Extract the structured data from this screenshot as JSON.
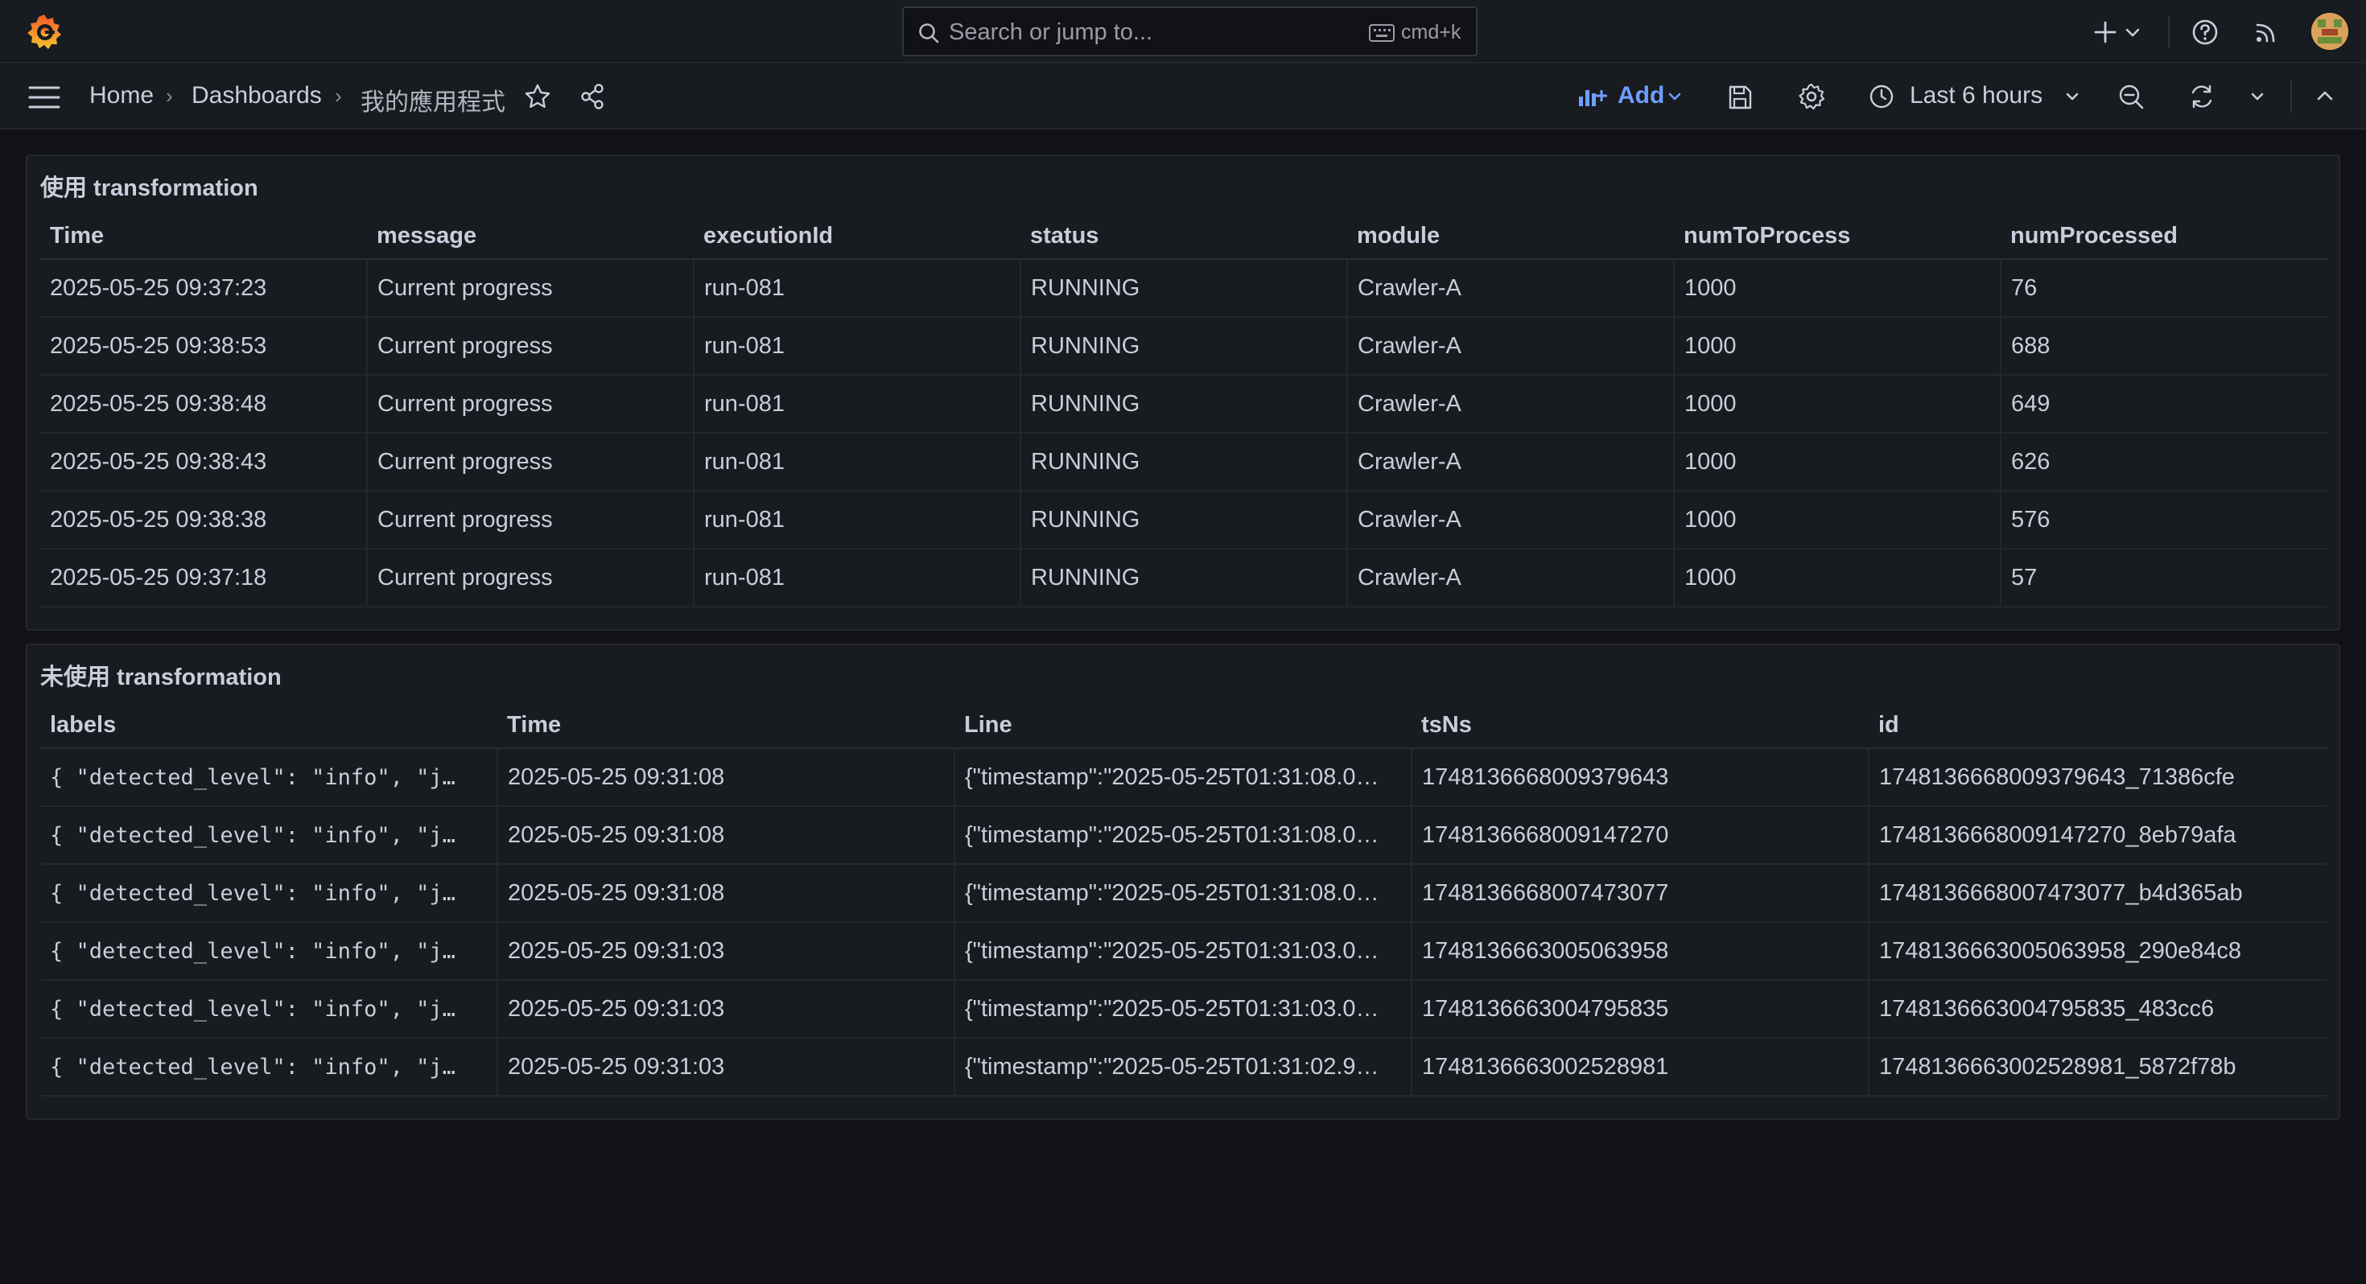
{
  "topbar": {
    "logo_icon": "grafana-logo-icon",
    "search": {
      "placeholder": "Search or jump to...",
      "shortcut": "cmd+k"
    },
    "icons": [
      "plus-icon",
      "chevron-down-icon",
      "help-icon",
      "news-icon",
      "avatar"
    ]
  },
  "navbar": {
    "breadcrumb": [
      "Home",
      "Dashboards",
      "我的應用程式"
    ],
    "add_label": "Add",
    "time_range": "Last 6 hours",
    "accent": "#6e9fff"
  },
  "panels": [
    {
      "title": "使用 transformation",
      "columns": [
        "Time",
        "message",
        "executionId",
        "status",
        "module",
        "numToProcess",
        "numProcessed"
      ],
      "rows": [
        [
          "2025-05-25 09:37:23",
          "Current progress",
          "run-081",
          "RUNNING",
          "Crawler-A",
          "1000",
          "76"
        ],
        [
          "2025-05-25 09:38:53",
          "Current progress",
          "run-081",
          "RUNNING",
          "Crawler-A",
          "1000",
          "688"
        ],
        [
          "2025-05-25 09:38:48",
          "Current progress",
          "run-081",
          "RUNNING",
          "Crawler-A",
          "1000",
          "649"
        ],
        [
          "2025-05-25 09:38:43",
          "Current progress",
          "run-081",
          "RUNNING",
          "Crawler-A",
          "1000",
          "626"
        ],
        [
          "2025-05-25 09:38:38",
          "Current progress",
          "run-081",
          "RUNNING",
          "Crawler-A",
          "1000",
          "576"
        ],
        [
          "2025-05-25 09:37:18",
          "Current progress",
          "run-081",
          "RUNNING",
          "Crawler-A",
          "1000",
          "57"
        ]
      ]
    },
    {
      "title": "未使用 transformation",
      "columns": [
        "labels",
        "Time",
        "Line",
        "tsNs",
        "id"
      ],
      "rows": [
        [
          "{ \"detected_level\": \"info\", \"j…",
          "2025-05-25 09:31:08",
          "{\"timestamp\":\"2025-05-25T01:31:08.0…",
          "1748136668009379643",
          "1748136668009379643_71386cfe"
        ],
        [
          "{ \"detected_level\": \"info\", \"j…",
          "2025-05-25 09:31:08",
          "{\"timestamp\":\"2025-05-25T01:31:08.0…",
          "1748136668009147270",
          "1748136668009147270_8eb79afa"
        ],
        [
          "{ \"detected_level\": \"info\", \"j…",
          "2025-05-25 09:31:08",
          "{\"timestamp\":\"2025-05-25T01:31:08.0…",
          "1748136668007473077",
          "1748136668007473077_b4d365ab"
        ],
        [
          "{ \"detected_level\": \"info\", \"j…",
          "2025-05-25 09:31:03",
          "{\"timestamp\":\"2025-05-25T01:31:03.0…",
          "1748136663005063958",
          "1748136663005063958_290e84c8"
        ],
        [
          "{ \"detected_level\": \"info\", \"j…",
          "2025-05-25 09:31:03",
          "{\"timestamp\":\"2025-05-25T01:31:03.0…",
          "1748136663004795835",
          "1748136663004795835_483cc6"
        ],
        [
          "{ \"detected_level\": \"info\", \"j…",
          "2025-05-25 09:31:03",
          "{\"timestamp\":\"2025-05-25T01:31:02.9…",
          "1748136663002528981",
          "1748136663002528981_5872f78b"
        ]
      ]
    }
  ]
}
